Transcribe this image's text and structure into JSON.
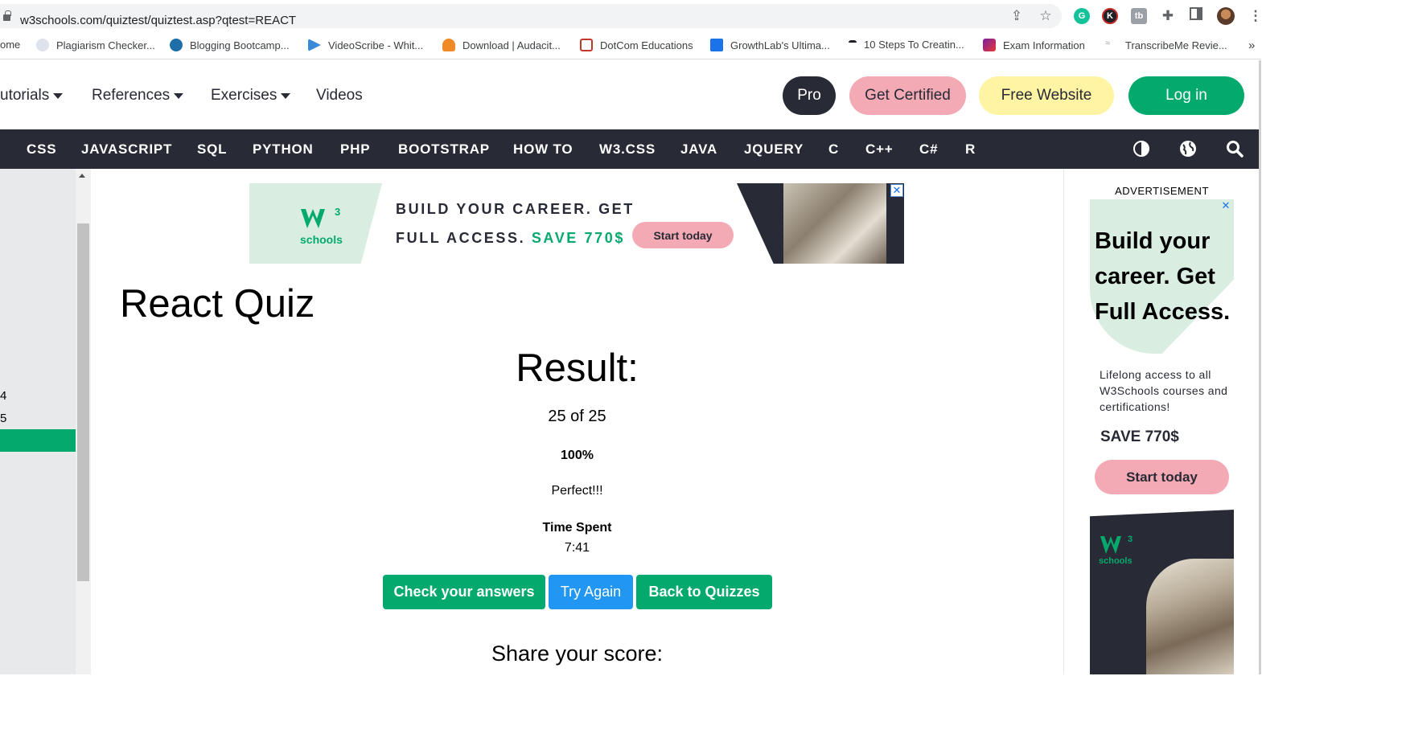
{
  "browser": {
    "url": "w3schools.com/quiztest/quiztest.asp?qtest=REACT",
    "bookmarks": [
      {
        "label": "ome"
      },
      {
        "label": "Plagiarism Checker...",
        "color": "#8fa8c8"
      },
      {
        "label": "Blogging Bootcamp...",
        "color": "#1e6fa8"
      },
      {
        "label": "VideoScribe - Whit...",
        "color": "#3b8ad9"
      },
      {
        "label": "Download | Audacit...",
        "color": "#f08a24"
      },
      {
        "label": "DotCom Educations",
        "color": "#c0392b"
      },
      {
        "label": "GrowthLab's Ultima...",
        "color": "#1a73e8"
      },
      {
        "label": "10 Steps To Creatin...",
        "color": "#202124"
      },
      {
        "label": "Exam Information",
        "color": "#7b1fa2"
      },
      {
        "label": "TranscribeMe Revie...",
        "color": "#9aa0a6"
      }
    ],
    "more_bookmarks": "»"
  },
  "topnav": {
    "tutorials": "utorials",
    "references": "References",
    "exercises": "Exercises",
    "videos": "Videos",
    "pro": "Pro",
    "get_certified": "Get Certified",
    "free_website": "Free Website",
    "login": "Log in"
  },
  "subnav": [
    "CSS",
    "JAVASCRIPT",
    "SQL",
    "PYTHON",
    "PHP",
    "BOOTSTRAP",
    "HOW TO",
    "W3.CSS",
    "JAVA",
    "JQUERY",
    "C",
    "C++",
    "C#",
    "R"
  ],
  "sidebar": {
    "items": [
      "4",
      "5"
    ]
  },
  "ad_banner": {
    "logo_sub": "schools",
    "line1": "BUILD YOUR CAREER. GET",
    "line2_prefix": "FULL ACCESS.",
    "line2_highlight": "SAVE 770$",
    "cta": "Start today"
  },
  "main": {
    "title": "React Quiz",
    "result_heading": "Result:",
    "score": "25 of 25",
    "percent": "100%",
    "message": "Perfect!!!",
    "time_label": "Time Spent",
    "time_value": "7:41",
    "buttons": {
      "check": "Check your answers",
      "try_again": "Try Again",
      "back": "Back to Quizzes"
    },
    "share": "Share your score:"
  },
  "right_ad": {
    "label": "ADVERTISEMENT",
    "headline": "Build your career. Get Full Access.",
    "sub": "Lifelong access to all W3Schools courses and certifications!",
    "save": "SAVE 770$",
    "cta": "Start today",
    "logo_sub": "schools"
  },
  "colors": {
    "green": "#04aa6d",
    "dark": "#282a35",
    "pink": "#f3aab5",
    "yellow": "#fff4a3",
    "blue": "#2196f3"
  }
}
